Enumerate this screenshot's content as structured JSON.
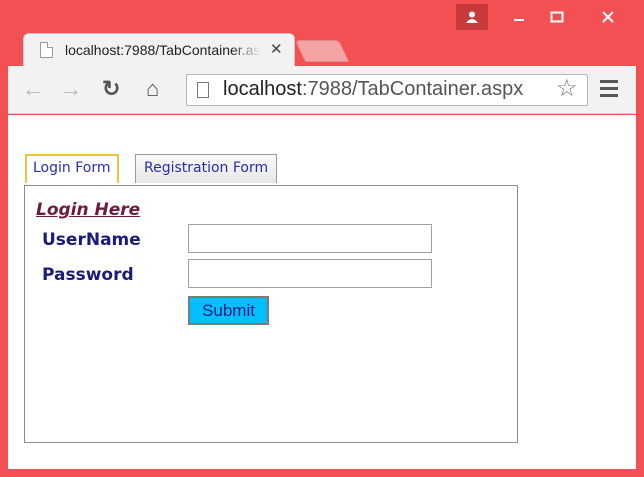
{
  "window": {
    "controls": {
      "user_icon": "person-icon",
      "minimize_icon": "minimize-icon",
      "maximize_icon": "maximize-icon",
      "close_icon": "close-icon"
    }
  },
  "browser": {
    "tab": {
      "title": "localhost:7988/TabContainer.aspx",
      "close": "✕"
    },
    "toolbar": {
      "back": "←",
      "forward": "→",
      "reload": "↻",
      "home": "⌂",
      "url_host": "localhost",
      "url_rest": ":7988/TabContainer.aspx",
      "star": "☆"
    }
  },
  "page": {
    "tabs": [
      {
        "label": "Login Form",
        "active": true
      },
      {
        "label": "Registration Form",
        "active": false
      }
    ],
    "form": {
      "heading": "Login Here",
      "username_label": "UserName",
      "password_label": "Password",
      "username_value": "",
      "password_value": "",
      "submit_label": "Submit"
    }
  },
  "colors": {
    "window_frame": "#f25052",
    "submit_bg": "#00bfff",
    "label_color": "#1b1b7e",
    "heading_color": "#6b1e3c"
  }
}
